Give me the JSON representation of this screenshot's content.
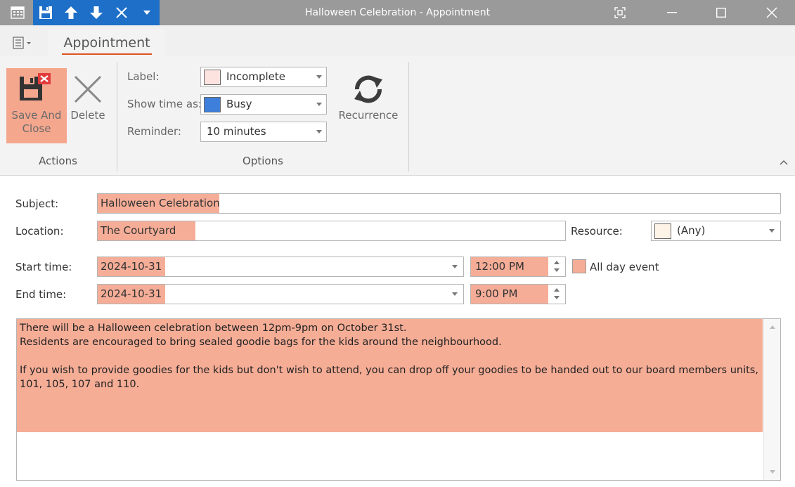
{
  "window": {
    "title": "Halloween Celebration - Appointment",
    "qat_icons": [
      "save-icon",
      "arrow-up-icon",
      "arrow-down-icon",
      "close-x-icon",
      "dropdown-icon"
    ]
  },
  "ribbon": {
    "active_tab": "Appointment",
    "actions": {
      "save_label_line1": "Save And",
      "save_label_line2": "Close",
      "delete_label": "Delete",
      "group_label": "Actions"
    },
    "options": {
      "label_caption": "Label:",
      "label_value": "Incomplete",
      "label_color": "#fde3e0",
      "show_time_caption": "Show time as:",
      "show_time_value": "Busy",
      "show_time_color": "#3f7fdc",
      "reminder_caption": "Reminder:",
      "reminder_value": "10 minutes",
      "recurrence_label": "Recurrence",
      "group_label": "Options"
    }
  },
  "form": {
    "subject_label": "Subject:",
    "subject_value": "Halloween Celebration",
    "location_label": "Location:",
    "location_value": "The Courtyard",
    "resource_label": "Resource:",
    "resource_value": "(Any)",
    "resource_color": "#fdf3e6",
    "start_label": "Start time:",
    "start_date": "2024-10-31",
    "start_time": "12:00 PM",
    "all_day_label": "All day event",
    "end_label": "End time:",
    "end_date": "2024-10-31",
    "end_time": "9:00 PM",
    "description": "There will be a Halloween celebration between 12pm-9pm on October 31st.\nResidents are encouraged to bring sealed goodie bags for the kids around the neighbourhood.\n\nIf you wish to provide goodies for the kids but don't wish to attend, you can drop off your goodies to be handed out to our board members units, 101, 105, 107 and 110."
  },
  "colors": {
    "accent_blue": "#1e6fc8",
    "highlight": "#f5ad97",
    "tab_underline": "#e0521e"
  }
}
